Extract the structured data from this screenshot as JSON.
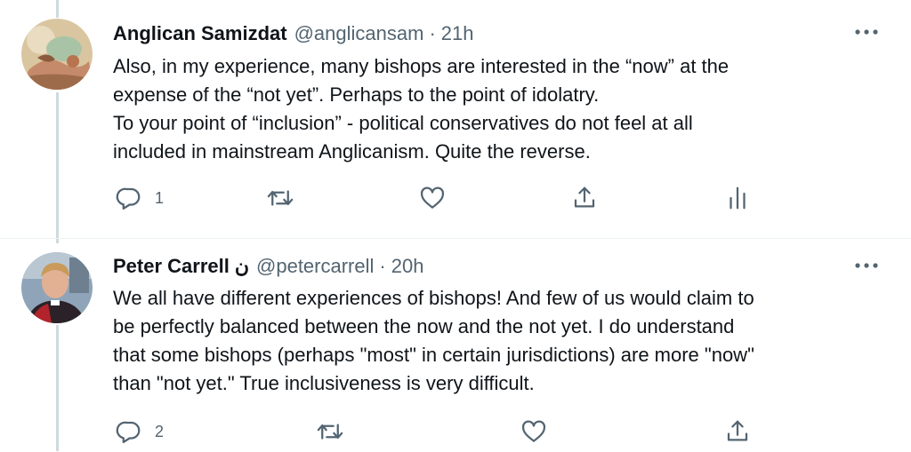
{
  "tweets": [
    {
      "name": "Anglican Samizdat",
      "handle": "@anglicansam",
      "separator": "·",
      "time": "21h",
      "avatar_icon": "painting-avatar",
      "body_lines": [
        "Also, in my experience, many bishops are interested in the “now” at the",
        "expense of the “not yet”. Perhaps to the point of idolatry.",
        "To your point of “inclusion” - political conservatives do not feel at all",
        "included in mainstream Anglicanism. Quite the reverse."
      ],
      "reply_count": "1",
      "has_analytics": true
    },
    {
      "name": "Peter Carrell",
      "name_emoji": "ن",
      "handle": "@petercarrell",
      "separator": "·",
      "time": "20h",
      "avatar_icon": "clergy-portrait-avatar",
      "body_lines": [
        "We all have different experiences of bishops! And few of us would claim to",
        "be perfectly balanced between the now and the not yet. I do understand",
        "that some bishops (perhaps \"most\" in certain jurisdictions) are more \"now\"",
        "than \"not yet.\" True inclusiveness is very difficult."
      ],
      "reply_count": "2",
      "has_analytics": false
    }
  ],
  "icons": {
    "reply": "reply-icon",
    "retweet": "retweet-icon",
    "like": "heart-icon",
    "share": "share-icon",
    "analytics": "analytics-icon",
    "more": "more-icon"
  },
  "colors": {
    "text": "#0f1419",
    "secondary": "#536471",
    "thread_line": "#cfd9de"
  }
}
